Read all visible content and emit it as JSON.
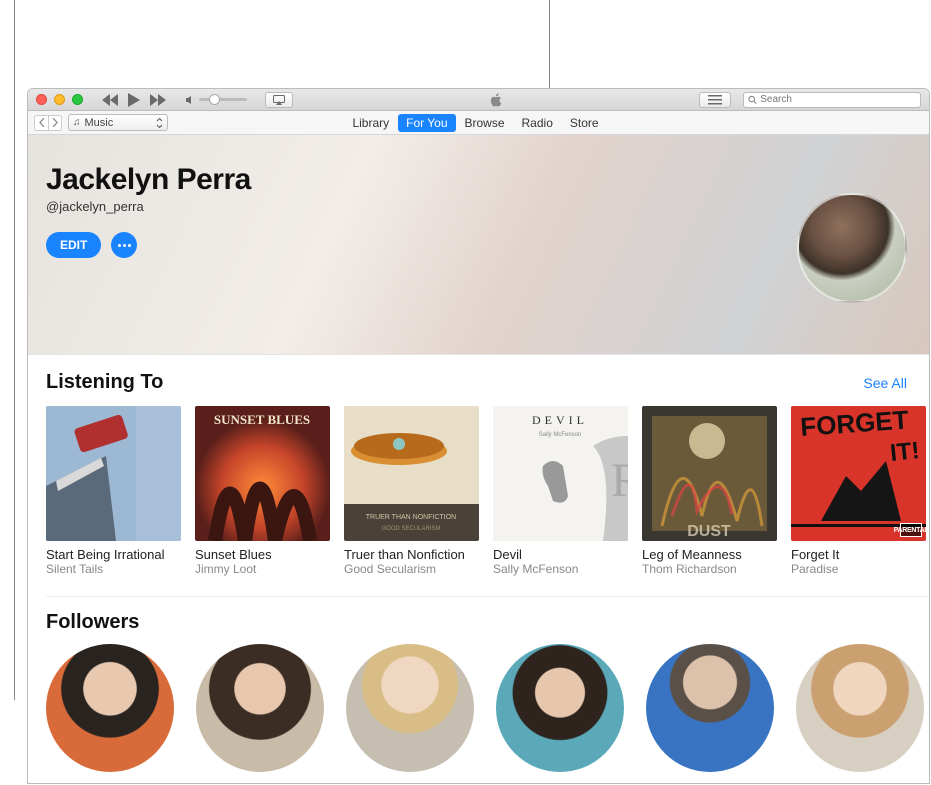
{
  "titlebar": {
    "search_placeholder": "Search"
  },
  "nav": {
    "selector_label": "Music",
    "tabs": [
      "Library",
      "For You",
      "Browse",
      "Radio",
      "Store"
    ],
    "active_tab_index": 1
  },
  "profile": {
    "name": "Jackelyn Perra",
    "handle": "@jackelyn_perra",
    "edit_label": "EDIT"
  },
  "listening": {
    "title": "Listening To",
    "see_all": "See All",
    "albums": [
      {
        "title": "Start Being Irrational",
        "artist": "Silent Tails"
      },
      {
        "title": "Sunset Blues",
        "artist": "Jimmy Loot"
      },
      {
        "title": "Truer than Nonfiction",
        "artist": "Good Secularism"
      },
      {
        "title": "Devil",
        "artist": "Sally McFenson"
      },
      {
        "title": "Leg of Meanness",
        "artist": "Thom Richardson"
      },
      {
        "title": "Forget It",
        "artist": "Paradise"
      }
    ]
  },
  "followers": {
    "title": "Followers"
  }
}
